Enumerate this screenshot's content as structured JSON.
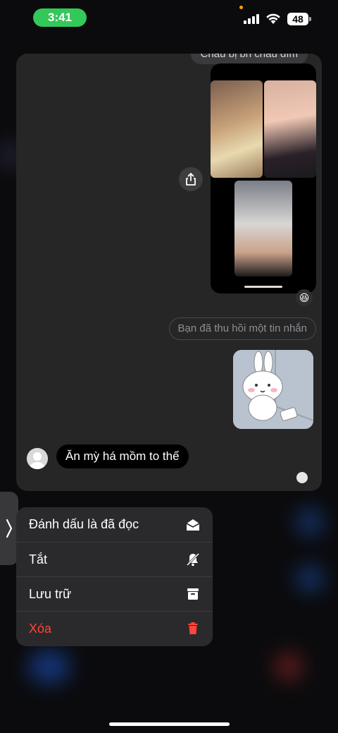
{
  "status_bar": {
    "time": "3:41",
    "battery": "48"
  },
  "conversation_preview": {
    "top_bubble_text": "Cháu bị bn cháu dìm",
    "recalled_notice": "Bạn đã thu hồi một tin nhắn",
    "incoming_message": "Ăn mỳ há mồm to thế",
    "reaction": "😆"
  },
  "context_menu": {
    "items": [
      {
        "label": "Đánh dấu là đã đọc",
        "icon": "envelope-open-icon"
      },
      {
        "label": "Tắt",
        "icon": "bell-slash-icon"
      },
      {
        "label": "Lưu trữ",
        "icon": "archive-box-icon"
      },
      {
        "label": "Xóa",
        "icon": "trash-icon",
        "color": "#ff453a"
      }
    ]
  },
  "colors": {
    "time_pill": "#34c759",
    "destructive": "#ff453a",
    "card_bg": "#262627"
  }
}
